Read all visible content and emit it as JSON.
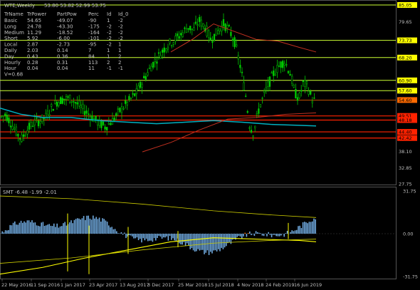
{
  "header": {
    "symbol": "WTE,Weekly",
    "ohlc": "53.80 53.82 52.99 53.75"
  },
  "info_table": {
    "columns": [
      "TrName",
      "TrPower",
      "PartPow",
      "Perc",
      "Id",
      "Id_0"
    ],
    "rows": [
      [
        "Basic",
        "54.65",
        "-49.07",
        "-90",
        "1",
        "-2"
      ],
      [
        "Long",
        "24.78",
        "-43.30",
        "-175",
        "-2",
        "-2"
      ],
      [
        "Medium",
        "11.29",
        "-18.52",
        "-164",
        "-2",
        "-2"
      ],
      [
        "Short",
        "5.92",
        "-6.00",
        "-101",
        "-2",
        "-2"
      ],
      [
        "Local",
        "2.87",
        "-2.73",
        "-95",
        "-2",
        "1"
      ],
      [
        "Daily",
        "2.03",
        "0.14",
        "7",
        "1",
        "1"
      ],
      [
        "Day",
        "0.43",
        "0.36",
        "84",
        "1",
        "2"
      ],
      [
        "Hourly",
        "0.28",
        "0.31",
        "113",
        "2",
        "2"
      ],
      [
        "Hour",
        "0.04",
        "0.04",
        "11",
        "-1",
        "-1"
      ]
    ],
    "footer": "V=0.68"
  },
  "price_axis": {
    "ticks": [
      "85.05",
      "79.65",
      "73.73",
      "68.20",
      "60.90",
      "57.60",
      "54.60",
      "49.51",
      "48.18",
      "44.40",
      "42.42",
      "38.10",
      "32.85",
      "27.75"
    ],
    "current_price": "54.60"
  },
  "sub_panel": {
    "label": "SMT -6.48 -1.99 -2.01",
    "ticks": [
      "31.75",
      "0.00",
      "-31.75"
    ]
  },
  "date_axis": [
    "22 May 2016",
    "11 Sep 2016",
    "1 Jan 2017",
    "23 Apr 2017",
    "13 Aug 2017",
    "3 Dec 2017",
    "25 Mar 2018",
    "15 Jul 2018",
    "4 Nov 2018",
    "24 Feb 2019",
    "16 Jun 2019"
  ],
  "colors": {
    "background": "#000000",
    "candle_up": "#00cc00",
    "candle_down": "#00cc00",
    "level_yellow": "#ccff33",
    "level_red": "#ff2200",
    "ma_cyan": "#00b0c0",
    "ma_red": "#c03020",
    "hist_orange": "#ff6a00",
    "hist_blue": "#6fa8dc",
    "hist_yellow": "#ffff00"
  }
}
